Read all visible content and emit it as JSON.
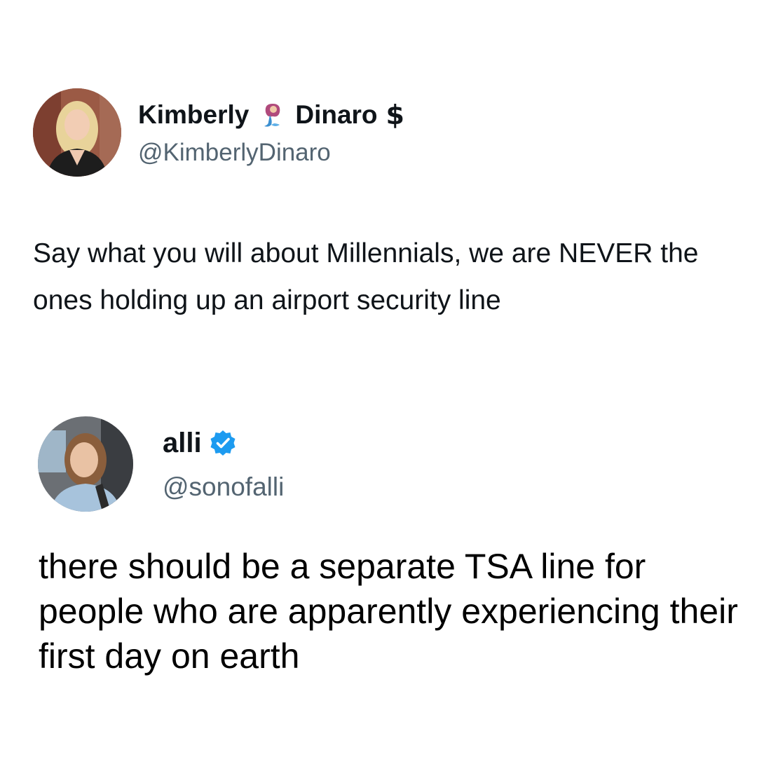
{
  "tweets": [
    {
      "name_first": "Kimberly",
      "name_last": "Dinaro",
      "name_emoji_icon": "mermaid-emoji-icon",
      "name_suffix_symbol": "$",
      "handle": "@KimberlyDinaro",
      "text": "Say what you will about Millennials, we are NEVER the ones holding up an airport security line"
    },
    {
      "name": "alli",
      "verified_icon": "verified-badge-icon",
      "verified_color": "#1d9bf0",
      "handle": "@sonofalli",
      "text": "there should be a separate TSA line for people who are apparently experiencing their first day on earth"
    }
  ]
}
